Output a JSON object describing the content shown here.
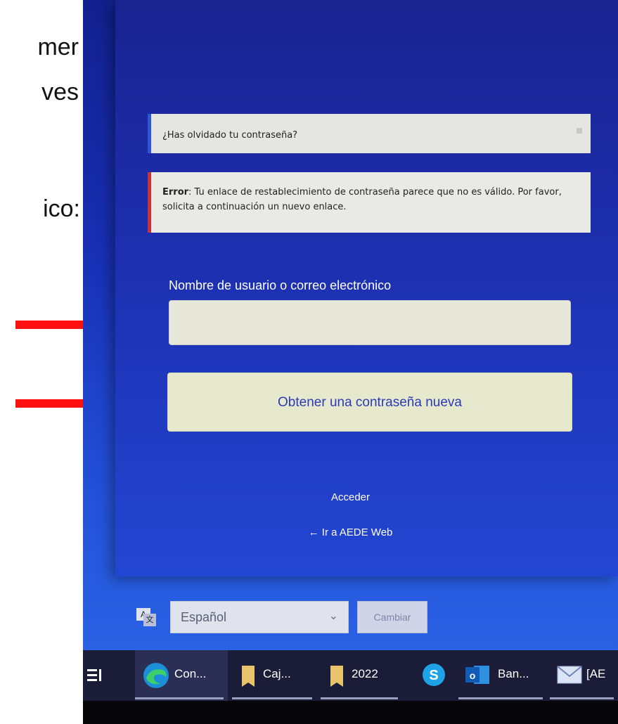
{
  "slide": {
    "line1": "mer",
    "line2": "ves",
    "line3": "ico:"
  },
  "page": {
    "notice": "¿Has olvidado tu contraseña?",
    "error_label": "Error",
    "error_text": ": Tu enlace de restablecimiento de contraseña parece que no es válido. Por favor, solicita a continuación un nuevo enlace.",
    "username_label": "Nombre de usuario o correo electrónico",
    "username_value": "",
    "submit_label": "Obtener una contraseña nueva",
    "login_link": "Acceder",
    "back_link": "← Ir a AEDE Web"
  },
  "language": {
    "selected": "Español",
    "change_label": "Cambiar"
  },
  "taskbar": {
    "items": [
      {
        "label": "Con...",
        "icon": "edge-browser-icon"
      },
      {
        "label": "Caj...",
        "icon": "folder-icon"
      },
      {
        "label": "2022",
        "icon": "folder-icon"
      },
      {
        "label": "",
        "icon": "skype-icon"
      },
      {
        "label": "Ban...",
        "icon": "outlook-icon"
      },
      {
        "label": "[AE",
        "icon": "mail-icon"
      }
    ]
  },
  "colors": {
    "background_blue": "#1d2fb0",
    "error_border": "#c8323a",
    "notice_border": "#2d55d6",
    "arrow": "#ff1010"
  }
}
